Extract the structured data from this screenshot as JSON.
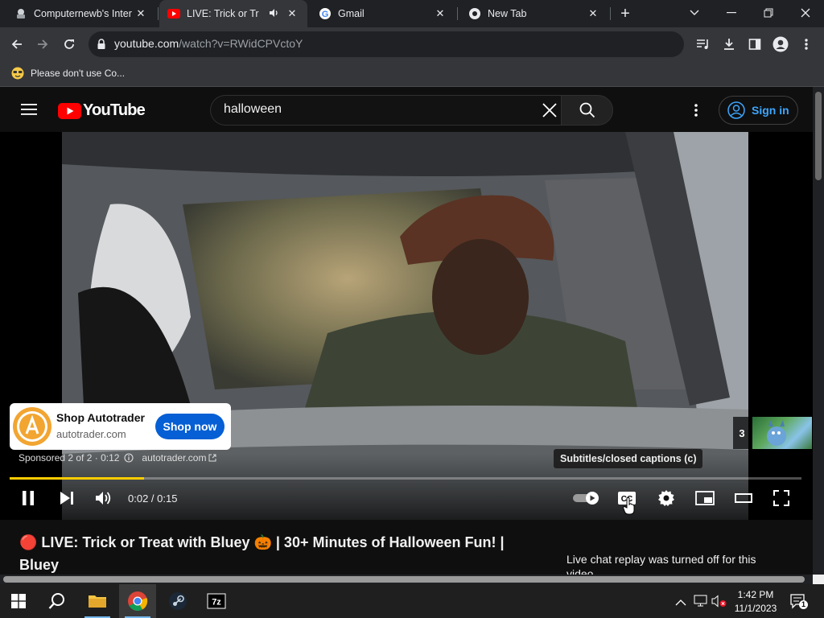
{
  "browser": {
    "tabs": [
      {
        "title": "Computernewb's Inter",
        "close": "✕",
        "active": false
      },
      {
        "title": "LIVE: Trick or Tr",
        "close": "✕",
        "active": true
      },
      {
        "title": "Gmail",
        "close": "✕",
        "active": false
      },
      {
        "title": "New Tab",
        "close": "✕",
        "active": false
      }
    ],
    "new_tab": "+",
    "url_host": "youtube.com",
    "url_path": "/watch?v=RWidCPVctoY",
    "bookmark": "Please don't use Co..."
  },
  "youtube": {
    "logo_text": "YouTube",
    "search_value": "halloween",
    "signin_label": "Sign in",
    "ad": {
      "name": "Shop Autotrader",
      "domain": "autotrader.com",
      "button": "Shop now",
      "sponsored": "Sponsored 2 of 2 · 0:12",
      "link": "autotrader.com"
    },
    "tooltip": "Subtitles/closed captions (c)",
    "up_next_count": "3",
    "time": "0:02 / 0:15",
    "progress": 0.17,
    "progress_color": "#ffcc00",
    "title": "🔴 LIVE: Trick or Treat with Bluey 🎃 | 30+ Minutes of Halloween Fun! | Bluey",
    "chat_note": "Live chat replay was turned off for this video."
  },
  "taskbar": {
    "time": "1:42 PM",
    "date": "11/1/2023",
    "notifications": "1"
  }
}
